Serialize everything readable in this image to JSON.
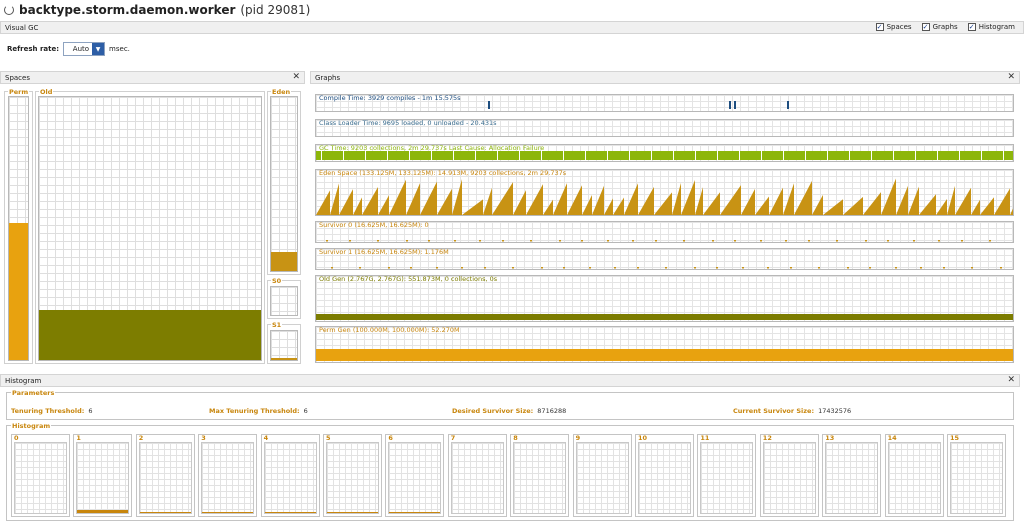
{
  "window": {
    "title_bold": "backtype.storm.daemon.worker",
    "title_pid": "(pid 29081)"
  },
  "visual_gc": {
    "label": "Visual GC",
    "checkboxes": [
      {
        "label": "Spaces",
        "checked": true
      },
      {
        "label": "Graphs",
        "checked": true
      },
      {
        "label": "Histogram",
        "checked": true
      }
    ],
    "refresh_label": "Refresh rate:",
    "refresh_value": "Auto",
    "refresh_unit": "msec."
  },
  "spaces": {
    "label": "Spaces",
    "perm": {
      "label": "Perm",
      "fill": 0.52
    },
    "old": {
      "label": "Old",
      "fill": 0.19
    },
    "eden": {
      "label": "Eden",
      "fill": 0.11
    },
    "s0": {
      "label": "S0",
      "fill": 0.0
    },
    "s1": {
      "label": "S1",
      "fill": 0.07
    }
  },
  "graphs": {
    "label": "Graphs",
    "compile": "Compile Time: 3929 compiles - 1m 15.575s",
    "classloader": "Class Loader Time: 9695 loaded, 0 unloaded - 20.431s",
    "gc": "GC Time: 9203 collections, 2m 29.737s  Last Cause: Allocation Failure",
    "eden": "Eden Space (133.125M, 133.125M): 14.913M, 9203 collections, 2m 29.737s",
    "survivor0": "Survivor 0 (16.625M, 16.625M): 0",
    "survivor1": "Survivor 1 (16.625M, 16.625M): 1.176M",
    "oldgen": "Old Gen (2.767G, 2.767G): 551.873M, 0 collections, 0s",
    "permgen": "Perm Gen (100.000M, 100.000M): 52.270M"
  },
  "histogram": {
    "label": "Histogram",
    "params_label": "Parameters",
    "tenuring_threshold_label": "Tenuring Threshold:",
    "tenuring_threshold": "6",
    "max_tenuring_label": "Max Tenuring Threshold:",
    "max_tenuring": "6",
    "desired_survivor_label": "Desired Survivor Size:",
    "desired_survivor": "8716288",
    "current_survivor_label": "Current Survivor Size:",
    "current_survivor": "17432576",
    "histogram_label": "Histogram",
    "buckets": [
      {
        "label": "0",
        "fill": 0.0
      },
      {
        "label": "1",
        "fill": 0.04
      },
      {
        "label": "2",
        "fill": 0.01
      },
      {
        "label": "3",
        "fill": 0.01
      },
      {
        "label": "4",
        "fill": 0.01
      },
      {
        "label": "5",
        "fill": 0.01
      },
      {
        "label": "6",
        "fill": 0.01
      },
      {
        "label": "7",
        "fill": 0.0
      },
      {
        "label": "8",
        "fill": 0.0
      },
      {
        "label": "9",
        "fill": 0.0
      },
      {
        "label": "10",
        "fill": 0.0
      },
      {
        "label": "11",
        "fill": 0.0
      },
      {
        "label": "12",
        "fill": 0.0
      },
      {
        "label": "13",
        "fill": 0.0
      },
      {
        "label": "14",
        "fill": 0.0
      },
      {
        "label": "15",
        "fill": 0.0
      }
    ]
  },
  "colors": {
    "perm": "#e8a20f",
    "old": "#7d7d00",
    "eden": "#c89314",
    "gc": "#8db60a",
    "label_orange": "#c8860d",
    "compile_label": "#1e4e80"
  },
  "icons": {
    "close": "close-icon",
    "dropdown": "chevron-down-icon",
    "spinner": "loading-icon",
    "check": "checkbox-check-icon"
  }
}
